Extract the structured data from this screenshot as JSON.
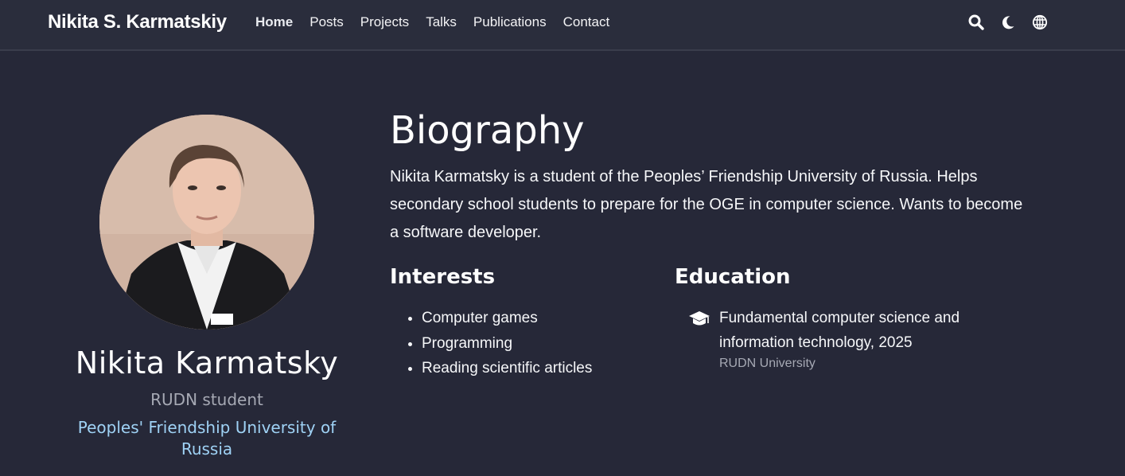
{
  "navbar": {
    "brand": "Nikita S. Karmatskiy",
    "links": [
      "Home",
      "Posts",
      "Projects",
      "Talks",
      "Publications",
      "Contact"
    ],
    "active_link": "Home",
    "icons": [
      "search-icon",
      "moon-icon",
      "globe-icon"
    ]
  },
  "profile": {
    "name": "Nikita Karmatsky",
    "role": "RUDN student",
    "organization": "Peoples' Friendship University of Russia"
  },
  "biography": {
    "title": "Biography",
    "text": "Nikita Karmatsky is a student of the Peoples’ Friendship University of Russia. Helps secondary school students to prepare for the OGE in computer science. Wants to become a software developer."
  },
  "interests": {
    "title": "Interests",
    "items": [
      "Computer games",
      "Programming",
      "Reading scientific articles"
    ]
  },
  "education": {
    "title": "Education",
    "items": [
      {
        "course": "Fundamental computer science and information technology, 2025",
        "institution": "RUDN University",
        "icon": "graduation-cap-icon"
      }
    ]
  },
  "colors": {
    "background": "#262838",
    "navbar": "#2a2d3c",
    "link": "#9fd2f5",
    "muted": "#a6a9b4"
  }
}
